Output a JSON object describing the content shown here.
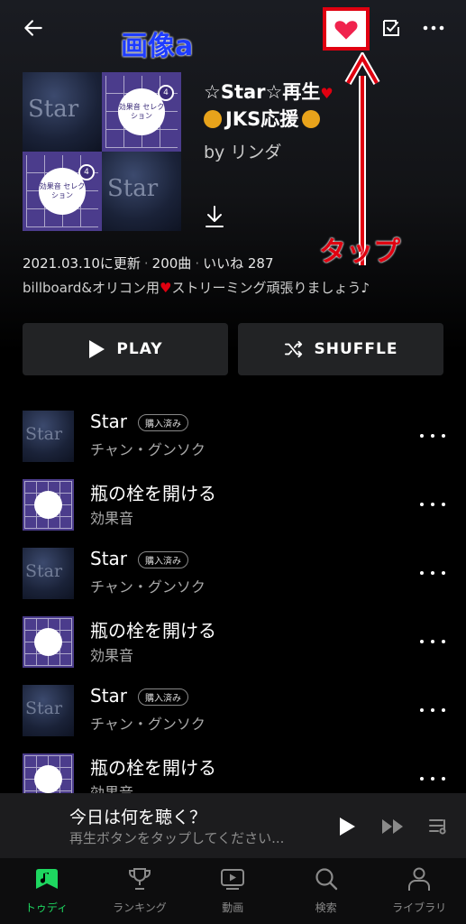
{
  "annotations": {
    "image_label": "画像a",
    "tap_label": "タップ"
  },
  "header": {
    "back_icon": "arrow-left-icon",
    "heart_icon": "heart-icon",
    "checklist_icon": "checklist-icon",
    "more_icon": "more-horizontal-icon"
  },
  "playlist": {
    "cover_tiles": [
      {
        "kind": "star",
        "text": "Star"
      },
      {
        "kind": "fx",
        "text": "効果音 セレクション",
        "badge": "4"
      },
      {
        "kind": "fx",
        "text": "効果音 セレクション",
        "badge": "4"
      },
      {
        "kind": "star",
        "text": "Star"
      }
    ],
    "title_line1": "☆Star☆再生",
    "title_line2": "JKS応援",
    "title_heart": "♥",
    "owner": "by リンダ",
    "meta_updated": "2021.03.10に更新",
    "meta_sep1": "·",
    "meta_count": "200曲",
    "meta_sep2": "·",
    "meta_likes": "いいね 287",
    "description_pre": "billboard&オリコン用",
    "description_heart": "♥",
    "description_post": "ストリーミング頑張りましょう♪"
  },
  "actions": {
    "play_label": "PLAY",
    "shuffle_label": "SHUFFLE"
  },
  "tracks": [
    {
      "title": "Star",
      "artist": "チャン・グンソク",
      "badge": "購入済み",
      "thumb": "star"
    },
    {
      "title": "瓶の栓を開ける",
      "artist": "効果音",
      "badge": "",
      "thumb": "fx"
    },
    {
      "title": "Star",
      "artist": "チャン・グンソク",
      "badge": "購入済み",
      "thumb": "star"
    },
    {
      "title": "瓶の栓を開ける",
      "artist": "効果音",
      "badge": "",
      "thumb": "fx"
    },
    {
      "title": "Star",
      "artist": "チャン・グンソク",
      "badge": "購入済み",
      "thumb": "star"
    },
    {
      "title": "瓶の栓を開ける",
      "artist": "効果音",
      "badge": "",
      "thumb": "fx"
    }
  ],
  "miniplayer": {
    "title": "今日は何を聴く？",
    "subtitle": "再生ボタンをタップしてください..."
  },
  "bottom_nav": [
    {
      "label": "トゥディ",
      "icon": "music-note-icon",
      "active": true
    },
    {
      "label": "ランキング",
      "icon": "trophy-icon",
      "active": false
    },
    {
      "label": "動画",
      "icon": "video-icon",
      "active": false
    },
    {
      "label": "検索",
      "icon": "search-icon",
      "active": false
    },
    {
      "label": "ライブラリ",
      "icon": "person-icon",
      "active": false
    }
  ],
  "colors": {
    "accent_green": "#1ed760",
    "annotation_red": "#e00010",
    "annotation_blue": "#1e3cff"
  }
}
